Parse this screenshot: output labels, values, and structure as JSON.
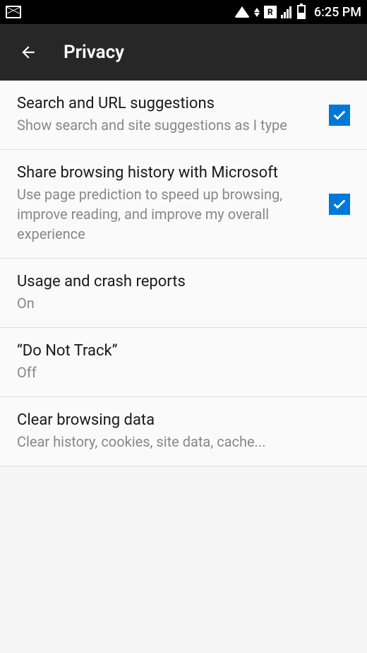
{
  "status_bar": {
    "time": "6:25 PM",
    "r_label": "R"
  },
  "header": {
    "title": "Privacy"
  },
  "settings": [
    {
      "title": "Search and URL suggestions",
      "subtitle": "Show search and site suggestions as I type",
      "checked": true
    },
    {
      "title": "Share browsing history with Microsoft",
      "subtitle": "Use page prediction to speed up browsing, improve reading, and improve my overall experience",
      "checked": true
    },
    {
      "title": "Usage and crash reports",
      "subtitle": "On",
      "checked": null
    },
    {
      "title": "“Do Not Track”",
      "subtitle": "Off",
      "checked": null
    },
    {
      "title": "Clear browsing data",
      "subtitle": "Clear history, cookies, site data, cache...",
      "checked": null
    }
  ]
}
